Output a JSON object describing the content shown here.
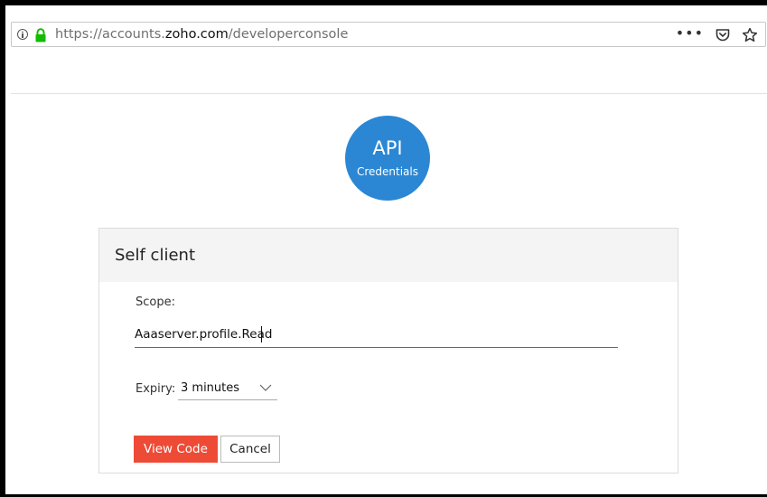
{
  "browser": {
    "url_prefix": "https://accounts.",
    "url_host": "zoho.com",
    "url_path": "/developerconsole",
    "more_glyph": "•••",
    "icons": [
      "info-icon",
      "lock-icon",
      "more-icon",
      "pocket-icon",
      "star-icon"
    ]
  },
  "badge": {
    "title": "API",
    "subtitle": "Credentials",
    "color": "#2b87d3"
  },
  "card": {
    "title": "Self client",
    "scope_label": "Scope:",
    "scope_value": "Aaaserver.profile.Read",
    "expiry_label": "Expiry:",
    "expiry_value": "3 minutes",
    "view_code_label": "View Code",
    "cancel_label": "Cancel",
    "accent_color": "#ee4b37"
  }
}
